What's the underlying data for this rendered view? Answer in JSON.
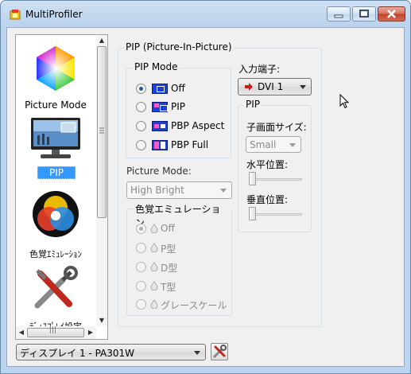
{
  "window": {
    "title": "MultiProfiler"
  },
  "sidebar": {
    "items": [
      {
        "label": "Picture Mode",
        "icon": "color-hexagon-icon"
      },
      {
        "label": "PIP",
        "icon": "monitor-icon",
        "selected": true
      },
      {
        "label": "色覚ｴﾐｭﾚｰｼｮﾝ",
        "icon": "color-vision-circles-icon"
      },
      {
        "label": "ﾃﾞｨｽﾌﾟﾚｲ設定",
        "icon": "tools-icon"
      }
    ],
    "hscroll_grip": "|||"
  },
  "pip": {
    "group_title": "PIP (Picture-In-Picture)",
    "mode": {
      "title": "PIP Mode",
      "options": [
        "Off",
        "PIP",
        "PBP Aspect",
        "PBP Full"
      ],
      "selected": "Off"
    },
    "input": {
      "label": "入力端子:",
      "value": "DVI 1"
    },
    "sub": {
      "title": "PIP",
      "size_label": "子画面サイズ:",
      "size_value": "Small",
      "h_label": "水平位置:",
      "v_label": "垂直位置:"
    },
    "picture_mode": {
      "label": "Picture Mode:",
      "value": "High Bright"
    },
    "color_emulation": {
      "title": "色覚エミュレーション",
      "options": [
        "Off",
        "P型",
        "D型",
        "T型",
        "グレースケール"
      ],
      "selected": "Off"
    }
  },
  "footer": {
    "display_value": "ディスプレイ 1 - PA301W"
  },
  "colors": {
    "accent": "#3399ff",
    "arrow": "#d11b1b",
    "pip_icon": "#1b40d6"
  }
}
